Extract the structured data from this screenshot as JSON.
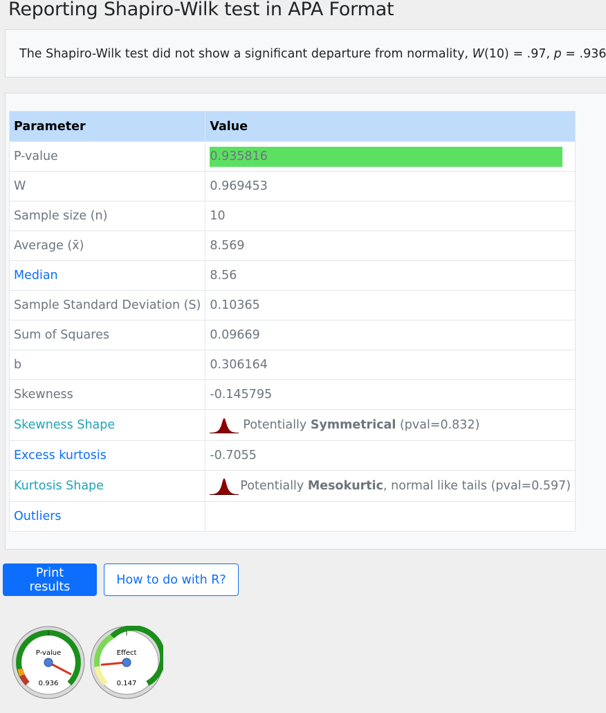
{
  "page": {
    "title": "Reporting Shapiro-Wilk test in APA Format"
  },
  "apa": {
    "prefix": "The Shapiro-Wilk test did not show a significant departure from normality, ",
    "w_symbol": "W",
    "w_df": "(10) = .97, ",
    "p_symbol": "p",
    "p_rest": " = .936"
  },
  "table": {
    "headers": {
      "parameter": "Parameter",
      "value": "Value"
    },
    "rows": {
      "pvalue": {
        "label": "P-value",
        "value": "0.935816",
        "fill_fraction": 0.935816
      },
      "w": {
        "label": "W",
        "value": "0.969453"
      },
      "n": {
        "label": "Sample size (n)",
        "value": "10"
      },
      "average": {
        "label": "Average (x̄)",
        "value": "8.569"
      },
      "median": {
        "label": "Median",
        "value": "8.56"
      },
      "sd": {
        "label": "Sample Standard Deviation (S)",
        "value": "0.10365"
      },
      "ss": {
        "label": "Sum of Squares",
        "value": "0.09669"
      },
      "b": {
        "label": "b",
        "value": "0.306164"
      },
      "skewness": {
        "label": "Skewness",
        "value": "-0.145795"
      },
      "skew_shape": {
        "label": "Skewness Shape",
        "prefix": "Potentially ",
        "bold": "Symmetrical",
        "suffix": " (pval=0.832)",
        "icon": "normal-curve-icon"
      },
      "kurtosis": {
        "label": "Excess kurtosis",
        "value": "-0.7055"
      },
      "kurt_shape": {
        "label": "Kurtosis Shape",
        "prefix": "Potentially ",
        "bold": "Mesokurtic",
        "suffix": ", normal like tails (pval=0.597)",
        "icon": "normal-curve-icon"
      },
      "outliers": {
        "label": "Outliers",
        "value": ""
      }
    }
  },
  "buttons": {
    "print": "Print results",
    "r_howto": "How to do with R?"
  },
  "gauges": {
    "pvalue": {
      "title": "P-value",
      "value": "0.936",
      "level": 0.936
    },
    "effect": {
      "title": "Effect",
      "value": "0.147",
      "level": 0.147
    }
  },
  "colors": {
    "accent": "#0d6efd",
    "header_bg": "#bfdcfb",
    "pbar": "#5be062",
    "link_teal": "#1fa2b8",
    "curve": "#8b0000"
  }
}
